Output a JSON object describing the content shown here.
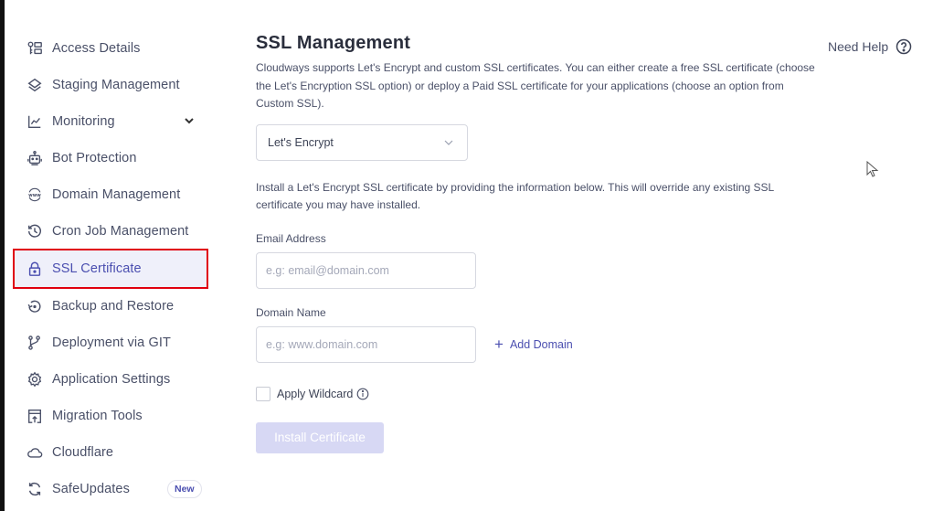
{
  "sidebar": {
    "items": [
      {
        "label": "Access Details",
        "icon": "key-list-icon"
      },
      {
        "label": "Staging Management",
        "icon": "layers-icon"
      },
      {
        "label": "Monitoring",
        "icon": "chart-line-icon",
        "expandable": true
      },
      {
        "label": "Bot Protection",
        "icon": "robot-icon"
      },
      {
        "label": "Domain Management",
        "icon": "www-globe-icon"
      },
      {
        "label": "Cron Job Management",
        "icon": "history-clock-icon"
      },
      {
        "label": "SSL Certificate",
        "icon": "lock-icon",
        "active": true
      },
      {
        "label": "Backup and Restore",
        "icon": "restore-icon"
      },
      {
        "label": "Deployment via GIT",
        "icon": "git-branch-icon"
      },
      {
        "label": "Application Settings",
        "icon": "gear-icon"
      },
      {
        "label": "Migration Tools",
        "icon": "migration-upload-icon"
      },
      {
        "label": "Cloudflare",
        "icon": "cloud-icon"
      },
      {
        "label": "SafeUpdates",
        "icon": "refresh-icon",
        "badge": "New"
      }
    ]
  },
  "header": {
    "title": "SSL Management",
    "help_label": "Need Help"
  },
  "main": {
    "description": "Cloudways supports Let's Encrypt and custom SSL certificates. You can either create a free SSL certificate (choose the Let's Encryption SSL option) or deploy a Paid SSL certificate for your applications (choose an option from Custom SSL).",
    "ssl_type_selected": "Let's Encrypt",
    "info_text": "Install a Let's Encrypt SSL certificate by providing the information below. This will override any existing SSL certificate you may have installed.",
    "email": {
      "label": "Email Address",
      "placeholder": "e.g: email@domain.com",
      "value": ""
    },
    "domain": {
      "label": "Domain Name",
      "placeholder": "e.g: www.domain.com",
      "value": ""
    },
    "add_domain_label": "Add Domain",
    "wildcard_label": "Apply Wildcard",
    "wildcard_checked": false,
    "install_button_label": "Install Certificate"
  },
  "colors": {
    "accent": "#4b4fb0",
    "active_bg": "#eff0fa",
    "highlight_border": "#e0000f",
    "disabled_button": "#d7d8f4"
  }
}
